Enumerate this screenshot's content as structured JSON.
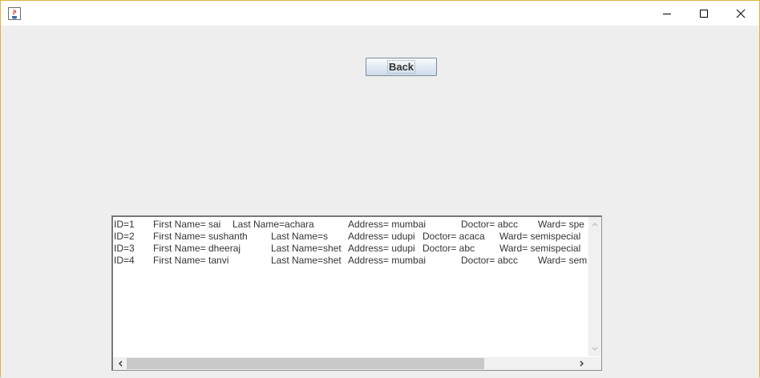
{
  "window": {
    "title": "",
    "controls": [
      "minimize-icon",
      "maximize-icon",
      "close-icon"
    ]
  },
  "back_button": {
    "label": "Back"
  },
  "records": [
    {
      "id": "ID=1",
      "first_name": "First Name= sai",
      "last_name": "Last Name=achara",
      "address": "Address= mumbai",
      "doctor": "Doctor= abcc",
      "ward": "Ward= spe"
    },
    {
      "id": "ID=2",
      "first_name": "First Name= sushanth",
      "last_name": "Last Name=s",
      "address": "Address= udupi",
      "doctor": "Doctor= acaca",
      "ward": "Ward= semispecial"
    },
    {
      "id": "ID=3",
      "first_name": "First Name= dheeraj",
      "last_name": "Last Name=shet",
      "address": "Address= udupi",
      "doctor": "Doctor= abc",
      "ward": "Ward= semispecial"
    },
    {
      "id": "ID=4",
      "first_name": "First Name= tanvi",
      "last_name": "Last Name=shet",
      "address": "Address= mumbai",
      "doctor": "Doctor= abcc",
      "ward": "Ward= sem"
    }
  ],
  "colors": {
    "window_border": "#e3b03a",
    "background": "#eeeeee",
    "button_border": "#7a8a99"
  }
}
